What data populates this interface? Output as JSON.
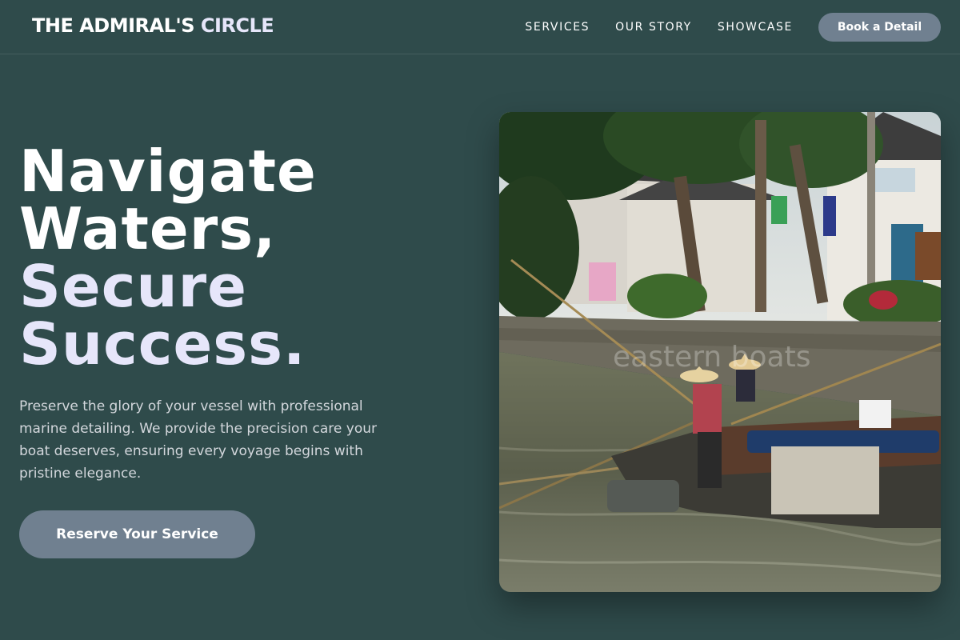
{
  "brand": {
    "part1": "THE ADMIRAL'S",
    "part2": "CIRCLE"
  },
  "nav": {
    "items": [
      "SERVICES",
      "OUR STORY",
      "SHOWCASE"
    ],
    "cta": "Book a Detail"
  },
  "hero": {
    "title_line1": "Navigate",
    "title_line2": "Waters,",
    "title_line3": "Secure",
    "title_line4": "Success.",
    "description": "Preserve the glory of your vessel with professional marine detailing. We provide the precision care your boat deserves, ensuring every voyage begins with pristine elegance.",
    "button": "Reserve Your Service"
  },
  "image": {
    "watermark": "eastern boats"
  },
  "colors": {
    "background": "#2f4b4b",
    "accent_text": "#e6e6fa",
    "button": "#708090"
  }
}
